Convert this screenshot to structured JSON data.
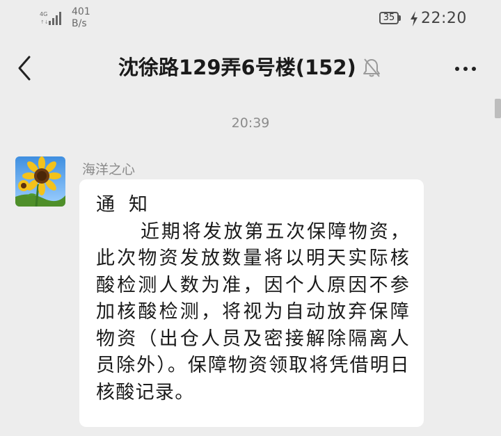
{
  "status_bar": {
    "network_type": "4G",
    "speed_value": "401",
    "speed_unit": "B/s",
    "battery_level": "35",
    "time": "22:20"
  },
  "header": {
    "title": "沈徐路129弄6号楼(152)",
    "back_icon": "chevron-left-icon",
    "mute_icon": "bell-off-icon",
    "more_icon": "more-horizontal-icon"
  },
  "chat": {
    "timestamp": "20:39",
    "messages": [
      {
        "sender": "海洋之心",
        "avatar": "sunflower-avatar",
        "heading": "通知",
        "body": "近期将发放第五次保障物资，此次物资发放数量将以明天实际核酸检测人数为准，因个人原因不参加核酸检测，将视为自动放弃保障物资（出仓人员及密接解除隔离人员除外）。保障物资领取将凭借明日核酸记录。"
      }
    ]
  }
}
